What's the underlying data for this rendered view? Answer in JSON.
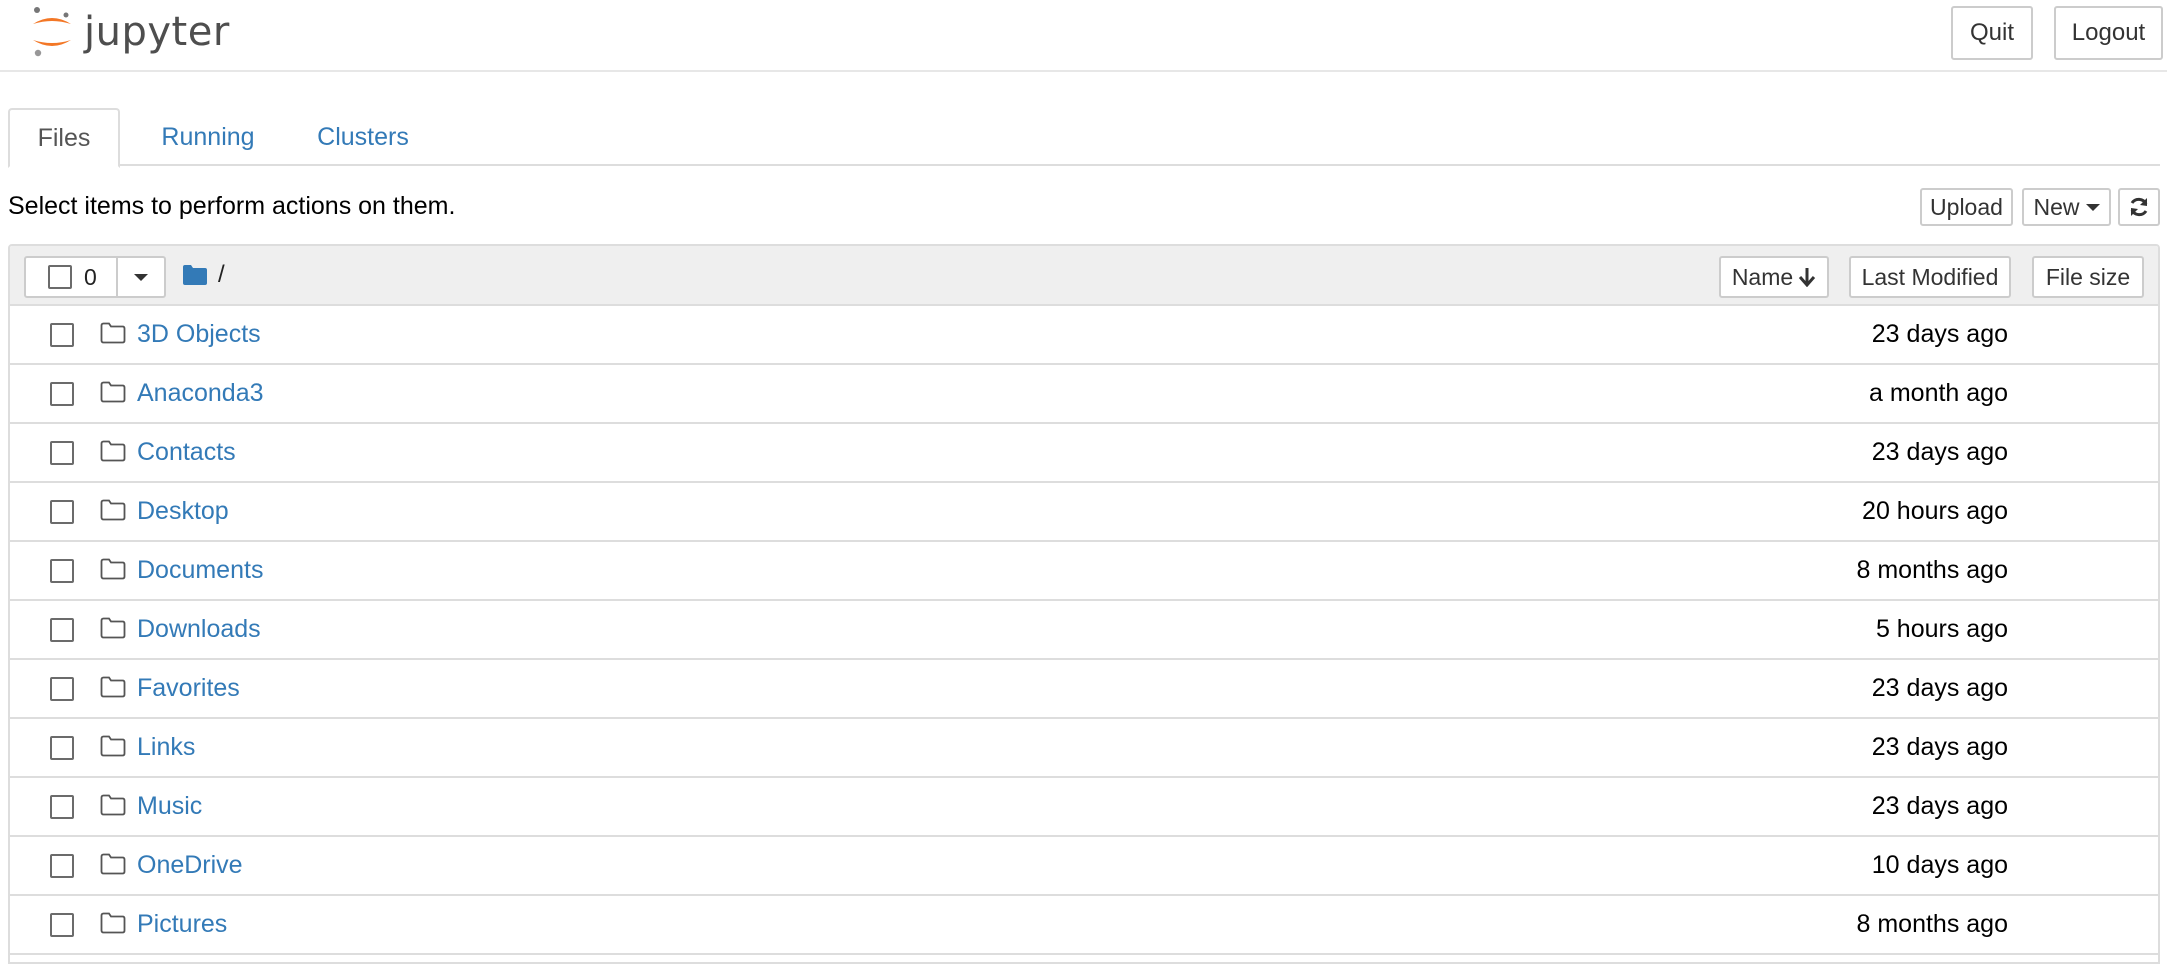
{
  "header": {
    "logo_text": "jupyter",
    "quit_label": "Quit",
    "logout_label": "Logout"
  },
  "tabs": [
    {
      "label": "Files",
      "active": true
    },
    {
      "label": "Running",
      "active": false
    },
    {
      "label": "Clusters",
      "active": false
    }
  ],
  "toolbar": {
    "hint": "Select items to perform actions on them.",
    "upload_label": "Upload",
    "new_label": "New",
    "refresh_icon": "refresh-icon"
  },
  "list_header": {
    "selected_count": "0",
    "path": "/",
    "name_label": "Name",
    "last_modified_label": "Last Modified",
    "file_size_label": "File size"
  },
  "colors": {
    "link": "#337ab7",
    "folder": "#555555",
    "header_bg": "#efefef",
    "logo_orange": "#f37726"
  },
  "rows": [
    {
      "name": "3D Objects",
      "modified": "23 days ago"
    },
    {
      "name": "Anaconda3",
      "modified": "a month ago"
    },
    {
      "name": "Contacts",
      "modified": "23 days ago"
    },
    {
      "name": "Desktop",
      "modified": "20 hours ago"
    },
    {
      "name": "Documents",
      "modified": "8 months ago"
    },
    {
      "name": "Downloads",
      "modified": "5 hours ago"
    },
    {
      "name": "Favorites",
      "modified": "23 days ago"
    },
    {
      "name": "Links",
      "modified": "23 days ago"
    },
    {
      "name": "Music",
      "modified": "23 days ago"
    },
    {
      "name": "OneDrive",
      "modified": "10 days ago"
    },
    {
      "name": "Pictures",
      "modified": "8 months ago"
    }
  ]
}
